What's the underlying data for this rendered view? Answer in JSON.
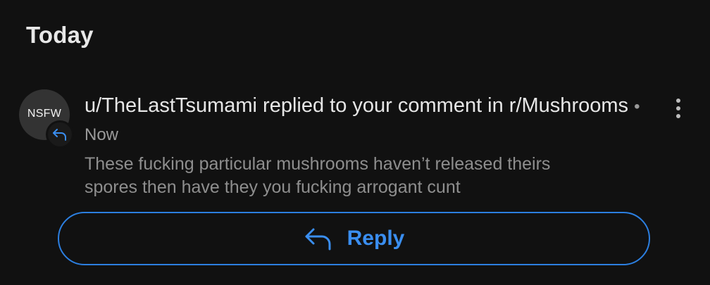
{
  "section": {
    "title": "Today"
  },
  "notification": {
    "avatar_text": "NSFW",
    "type_icon": "reply-arrow-icon",
    "headline": "u/TheLastTsumami replied to your comment in r/Mushrooms",
    "separator": "•",
    "timestamp": "Now",
    "preview": "These fucking particular mushrooms haven’t released theirs spores then have they you fucking arrogant cunt",
    "menu_icon": "more-vertical-icon"
  },
  "reply_button": {
    "label": "Reply",
    "icon": "reply-arrow-icon"
  },
  "colors": {
    "background": "#111111",
    "accent": "#3a8ef0",
    "primary_text": "#e6e6e6",
    "secondary_text": "#8e8e8e"
  }
}
